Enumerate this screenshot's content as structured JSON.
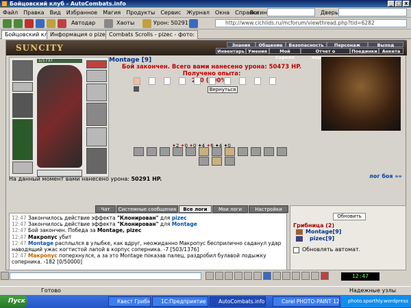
{
  "window": {
    "title": "Бойцовский клуб - AutoCombats.info"
  },
  "menu": [
    "Файл",
    "Правка",
    "Вид",
    "Избранное",
    "Магия",
    "Продукты",
    "Сервис",
    "Журнал",
    "Окна",
    "Справка"
  ],
  "toolbar": {
    "login_label": "Логин:",
    "door_label": "Дверь:",
    "autodar_label": "Автодар",
    "hautes_label": "Хаоты",
    "damage_label": "Урон: 50291",
    "address": "http://www.cichlids.ru/mcforum/viewthread.php?tid=6282"
  },
  "tabs": [
    "Бойцовский клуб",
    "Информация о pizec",
    "Combats Scrolls - pizec - фото:"
  ],
  "site": {
    "logo": "SUNCITY",
    "nav_top": [
      "Знания",
      "Общение",
      "Безопасность",
      "Персонаж",
      "Выход"
    ],
    "nav_bottom": [
      "Инвентарь",
      "Умения",
      "Мой Скролл",
      "Отчет о переводах",
      "Поединки",
      "Анкета"
    ]
  },
  "player": {
    "hp": "1/1737"
  },
  "battle": {
    "opponent": "Montage",
    "opponent_level": "[9]",
    "result_line1": "Бой закончен. Всего вами нанесено урона: 50473 HP. Получено опыта:",
    "result_line2": "270 (200%).",
    "back_button": "Вернуться",
    "stats": [
      "2",
      "0",
      "0",
      "4",
      "6",
      "4",
      "0"
    ],
    "damage_prefix": "На данный момент вами нанесено урона:",
    "damage_value": "50291 HP.",
    "log_link": "лог боя »»"
  },
  "chat": {
    "tabs": [
      "Чат",
      "Системные сообщения",
      "Все логи",
      "Мои логи",
      "Настройки"
    ],
    "active_tab": "Все логи",
    "lines": [
      {
        "time": "12:47",
        "pre": "Закончилось действие эффекта ",
        "bold": "\"Клонирован\"",
        "mid": " для ",
        "name": "pizec",
        "post": ""
      },
      {
        "time": "12:47",
        "pre": "Закончилось действие эффекта ",
        "bold": "\"Клонирован\"",
        "mid": " для ",
        "name": "Montage",
        "post": ""
      },
      {
        "time": "12:47",
        "pre": "Бой закончен. Победа за ",
        "bold": "Montage, pizec",
        "mid": "",
        "name": "",
        "post": ""
      },
      {
        "time": "12:47",
        "pre": "",
        "bold": "",
        "mid": "",
        "name": "Макропус",
        "post": " убит"
      },
      {
        "time": "12:47",
        "pre": "",
        "bold": "",
        "mid": "",
        "name": "Montage",
        "post": " расплылся в улыбке, как вдруг, неожиданно Макропус бесприлично саданул удар наводящий ужас когтистой лапой в корпус соперника. -7 [503/1376]"
      },
      {
        "time": "12:47",
        "pre": "",
        "bold": "",
        "mid": "",
        "name": "Макропус",
        "post": " поперхнулся, а за это Montage показав палец, раздробил булавой лодыжку соперника. -182 [0/50000]"
      }
    ]
  },
  "side": {
    "refresh_button": "Обновить",
    "room": "Грибница (2)",
    "users": [
      {
        "name": "Montage",
        "level": "[9]"
      },
      {
        "name": "pizec",
        "level": "[9]"
      }
    ],
    "auto_refresh_label": "Обновлять автомат."
  },
  "inputbar": {
    "clock": "12:47"
  },
  "status": {
    "left": "Готово",
    "right": "Надежные узлы"
  },
  "taskbar": {
    "start": "Пуск",
    "tasks": [
      "Квест Грибницы - Da...",
      "1С:Предприятие - Бу...",
      "AutoCombats.info",
      "Corel PHOTO-PAINT 12"
    ],
    "active": "AutoCombats.info",
    "tray": "photo.sporthly.wordpress"
  }
}
